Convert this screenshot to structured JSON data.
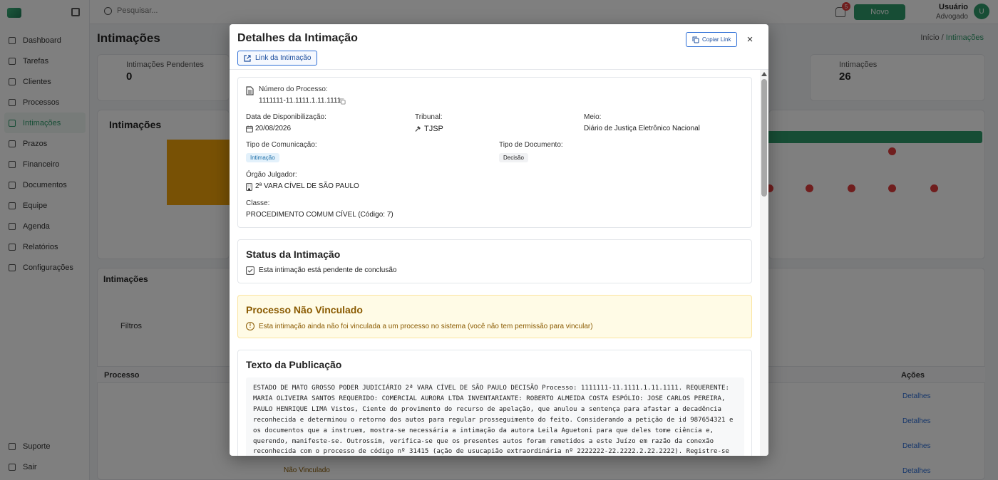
{
  "app": {
    "title": "Intimações",
    "breadcrumb": {
      "home": "Início",
      "current": "Intimações"
    },
    "search_placeholder": "Pesquisar...",
    "new_button": "Novo",
    "user": {
      "name": "Usuário",
      "role": "Advogado",
      "initials": "U"
    },
    "notification_count": "5"
  },
  "sidebar": {
    "items": [
      {
        "label": "Dashboard",
        "icon": "dashboard-icon"
      },
      {
        "label": "Tarefas",
        "icon": "tasks-icon"
      },
      {
        "label": "Clientes",
        "icon": "clients-icon"
      },
      {
        "label": "Processos",
        "icon": "process-icon"
      },
      {
        "label": "Intimações",
        "icon": "bell-icon"
      },
      {
        "label": "Prazos",
        "icon": "calendar-icon"
      },
      {
        "label": "Financeiro",
        "icon": "money-icon"
      },
      {
        "label": "Documentos",
        "icon": "document-icon"
      },
      {
        "label": "Equipe",
        "icon": "team-icon"
      },
      {
        "label": "Agenda",
        "icon": "agenda-icon"
      },
      {
        "label": "Relatórios",
        "icon": "report-icon"
      },
      {
        "label": "Configurações",
        "icon": "settings-icon"
      }
    ],
    "bottom": [
      {
        "label": "Suporte",
        "icon": "help-icon"
      },
      {
        "label": "Sair",
        "icon": "logout-icon"
      }
    ]
  },
  "background": {
    "card1_label": "Intimações Pendentes",
    "card1_value": "0",
    "card2_label": "Intimações",
    "card2_value": "26",
    "chart_title": "Intimações",
    "list_title": "Intimações",
    "filter_label": "Filtros",
    "table_header_first": "Processo",
    "table_header_last": "Ações",
    "row_link": "Detalhes",
    "row_status": "Não Vinculado"
  },
  "modal": {
    "title": "Detalhes da Intimação",
    "link_button": "Link da Intimação",
    "copy_button": "Copiar Link",
    "close_label": "×",
    "details": {
      "processo_label": "Número do Processo:",
      "processo_value": "1111111-11.1111.1.11.1111",
      "data_label": "Data de Disponibilização:",
      "data_value": "20/08/2026",
      "tribunal_label": "Tribunal:",
      "tribunal_value": "TJSP",
      "meio_label": "Meio:",
      "meio_value": "Diário de Justiça Eletrônico Nacional",
      "tipo_com_label": "Tipo de Comunicação:",
      "tipo_com_value": "Intimação",
      "tipo_doc_label": "Tipo de Documento:",
      "tipo_doc_value": "Decisão",
      "orgao_label": "Órgão Julgador:",
      "orgao_value": "2ª VARA CÍVEL DE SÃO PAULO",
      "classe_label": "Classe:",
      "classe_value": "PROCEDIMENTO COMUM CÍVEL (Código: 7)"
    },
    "status": {
      "title": "Status da Intimação",
      "text": "Esta intimação está pendente de conclusão"
    },
    "warning": {
      "title": "Processo Não Vinculado",
      "text": "Esta intimação ainda não foi vinculada a um processo no sistema (você não tem permissão para vincular)"
    },
    "publication": {
      "title": "Texto da Publicação",
      "text": "ESTADO DE MATO GROSSO PODER JUDICIÁRIO 2ª VARA CÍVEL DE SÃO PAULO DECISÃO Processo: 1111111-11.1111.1.11.1111. REQUERENTE: MARIA OLIVEIRA SANTOS REQUERIDO: COMERCIAL AURORA LTDA INVENTARIANTE: ROBERTO ALMEIDA COSTA ESPÓLIO: JOSE CARLOS PEREIRA, PAULO HENRIQUE LIMA Vistos, Ciente do provimento do recurso de apelação, que anulou a sentença para afastar a decadência reconhecida e determinou o retorno dos autos para regular prosseguimento do feito. Considerando a petição de id 987654321 e os documentos que a instruem, mostra-se necessária a intimação da autora Leila Aguetoni para que deles tome ciência e, querendo, manifeste-se. Outrossim, verifica-se que os presentes autos foram remetidos a este Juízo em razão da conexão reconhecida com o processo de código nº 31415 (ação de usucapião extraordinária nº 2222222-22.2222.2.22.2222). Registre-se que, nos autos da referida ação de usucapião, foi reconhecida a"
    }
  }
}
